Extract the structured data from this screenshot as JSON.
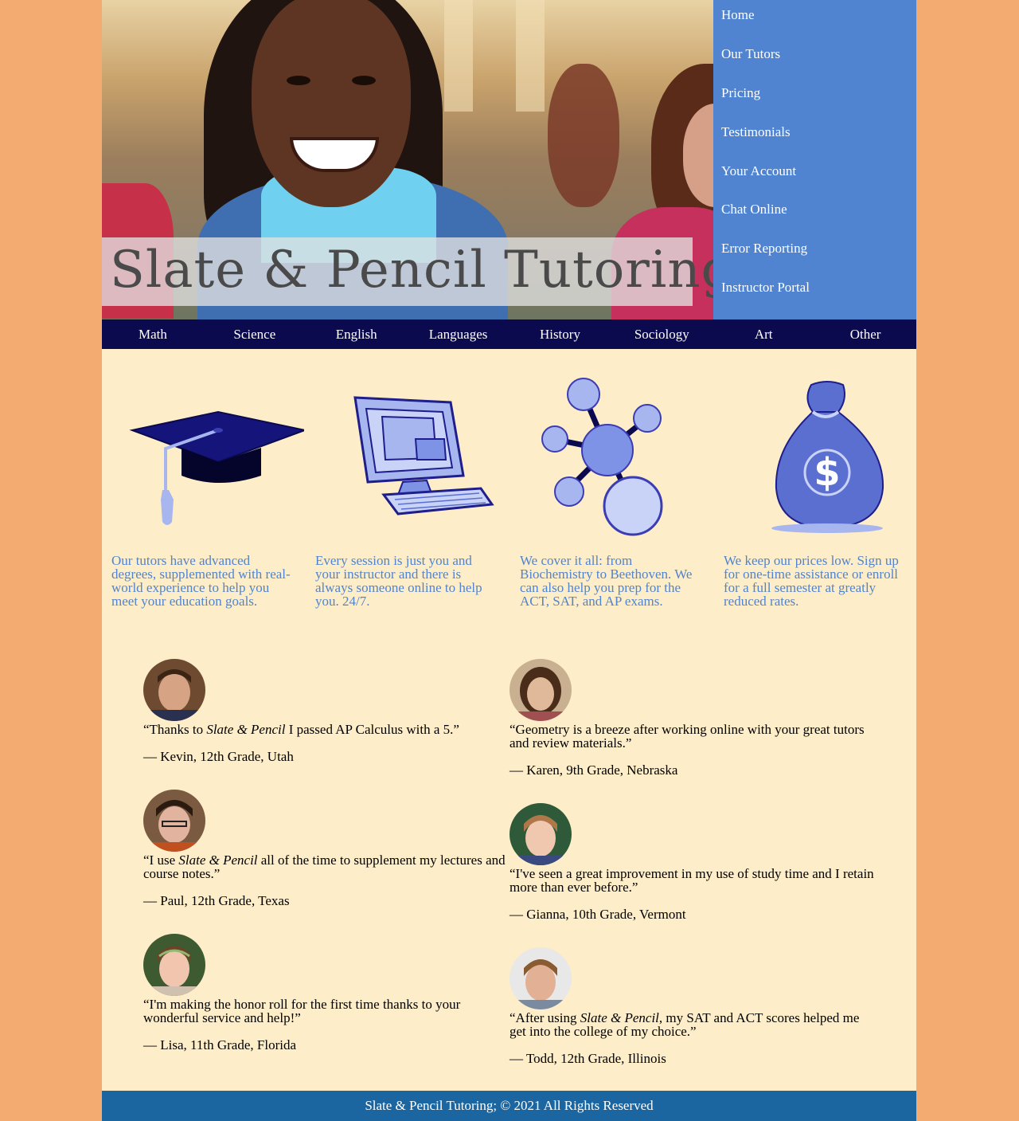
{
  "header": {
    "banner_title": "Slate & Pencil Tutoring"
  },
  "nav": {
    "items": [
      {
        "label": "Home"
      },
      {
        "label": "Our Tutors"
      },
      {
        "label": "Pricing"
      },
      {
        "label": "Testimonials"
      },
      {
        "label": "Your Account"
      },
      {
        "label": "Chat Online"
      },
      {
        "label": "Error Reporting"
      },
      {
        "label": "Instructor Portal"
      }
    ]
  },
  "subjects": {
    "items": [
      {
        "label": "Math"
      },
      {
        "label": "Science"
      },
      {
        "label": "English"
      },
      {
        "label": "Languages"
      },
      {
        "label": "History"
      },
      {
        "label": "Sociology"
      },
      {
        "label": "Art"
      },
      {
        "label": "Other"
      }
    ]
  },
  "features": [
    {
      "icon": "graduation-cap-icon",
      "text": "Our tutors have advanced degrees, supplemented with real-world experience to help you meet your education goals."
    },
    {
      "icon": "computer-icon",
      "text": "Every session is just you and your instructor and there is always someone online to help you. 24/7."
    },
    {
      "icon": "molecule-icon",
      "text": "We cover it all: from Biochemistry to Beethoven. We can also help you prep for the ACT, SAT, and AP exams."
    },
    {
      "icon": "money-bag-icon",
      "text": "We keep our prices low. Sign up for one-time assistance or enroll for a full semester at greatly reduced rates."
    }
  ],
  "testimonials": [
    {
      "pre": "“Thanks to ",
      "em": "Slate & Pencil",
      "post": " I passed AP Calculus with a 5.”",
      "author": "— Kevin, 12th Grade, Utah"
    },
    {
      "pre": "“Geometry is a breeze after working online with your great tutors and review materials.”",
      "em": "",
      "post": "",
      "author": "— Karen, 9th Grade, Nebraska"
    },
    {
      "pre": "“I use ",
      "em": "Slate & Pencil",
      "post": " all of the time to supplement my lectures and course notes.”",
      "author": "— Paul, 12th Grade, Texas"
    },
    {
      "pre": "“I've seen a great improvement in my use of study time and I retain more than ever before.”",
      "em": "",
      "post": "",
      "author": "— Gianna, 10th Grade, Vermont"
    },
    {
      "pre": "“I'm making the honor roll for the first time thanks to your wonderful service and help!”",
      "em": "",
      "post": "",
      "author": "— Lisa, 11th Grade, Florida"
    },
    {
      "pre": "“After using ",
      "em": "Slate & Pencil",
      "post": ", my SAT and ACT scores helped me get into the college of my choice.”",
      "author": "— Todd, 12th Grade, Illinois"
    }
  ],
  "footer": {
    "text": "Slate & Pencil Tutoring; © 2021 All Rights Reserved"
  },
  "colors": {
    "page_bg": "#f4ab72",
    "content_bg": "#fdedc8",
    "nav_bg": "#5084d0",
    "subject_bar_bg": "#0b0a4e",
    "feature_text": "#5084d0",
    "footer_bg": "#1b66a1"
  }
}
